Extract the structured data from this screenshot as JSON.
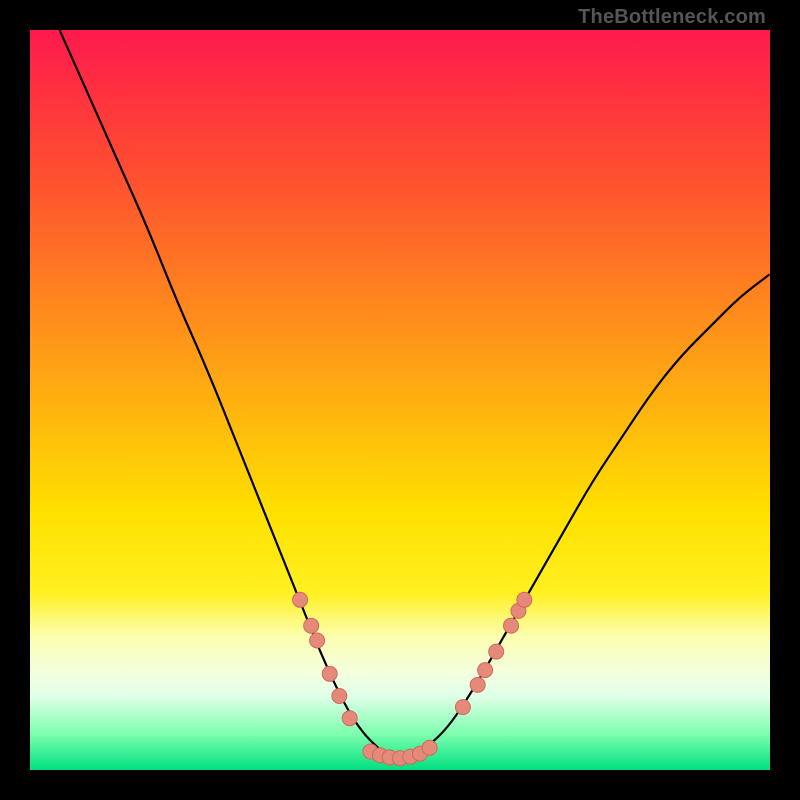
{
  "watermark": "TheBottleneck.com",
  "colors": {
    "curve": "#000000",
    "dot_fill": "#e58a7a",
    "dot_stroke": "#d06a5a",
    "gradient_top": "#ff1a4d",
    "gradient_bottom": "#00e080"
  },
  "chart_data": {
    "type": "line",
    "title": "",
    "xlabel": "",
    "ylabel": "",
    "xlim": [
      0,
      100
    ],
    "ylim": [
      0,
      100
    ],
    "grid": false,
    "legend": false,
    "curve_xy": [
      [
        4,
        100
      ],
      [
        8,
        91
      ],
      [
        12,
        82
      ],
      [
        16,
        73
      ],
      [
        20,
        63
      ],
      [
        24,
        54
      ],
      [
        28,
        44
      ],
      [
        32,
        34
      ],
      [
        36,
        24
      ],
      [
        40,
        14
      ],
      [
        44,
        6
      ],
      [
        48,
        2
      ],
      [
        50,
        1.5
      ],
      [
        52,
        2
      ],
      [
        56,
        5
      ],
      [
        60,
        11
      ],
      [
        64,
        18
      ],
      [
        68,
        25
      ],
      [
        72,
        32
      ],
      [
        76,
        39
      ],
      [
        80,
        45
      ],
      [
        84,
        51
      ],
      [
        88,
        56
      ],
      [
        92,
        60
      ],
      [
        96,
        64
      ],
      [
        100,
        67
      ]
    ],
    "series": [
      {
        "name": "left-branch-markers",
        "type": "scatter",
        "xy": [
          [
            36.5,
            23.0
          ],
          [
            38.0,
            19.5
          ],
          [
            38.8,
            17.5
          ],
          [
            40.5,
            13.0
          ],
          [
            41.8,
            10.0
          ],
          [
            43.2,
            7.0
          ]
        ]
      },
      {
        "name": "valley-floor-markers",
        "type": "scatter",
        "xy": [
          [
            46.0,
            2.5
          ],
          [
            47.3,
            2.0
          ],
          [
            48.6,
            1.7
          ],
          [
            50.0,
            1.6
          ],
          [
            51.4,
            1.8
          ],
          [
            52.7,
            2.2
          ],
          [
            54.0,
            3.0
          ]
        ]
      },
      {
        "name": "right-branch-markers",
        "type": "scatter",
        "xy": [
          [
            58.5,
            8.5
          ],
          [
            60.5,
            11.5
          ],
          [
            61.5,
            13.5
          ],
          [
            63.0,
            16.0
          ],
          [
            65.0,
            19.5
          ],
          [
            66.0,
            21.5
          ],
          [
            66.8,
            23.0
          ]
        ]
      }
    ]
  }
}
